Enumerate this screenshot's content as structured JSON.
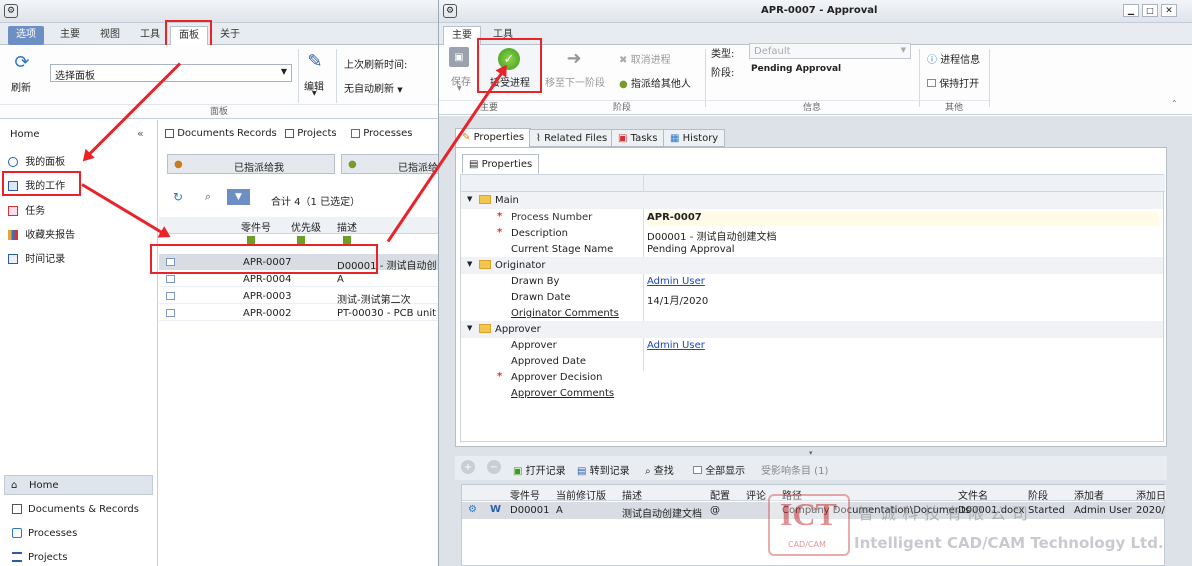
{
  "left": {
    "tabs": [
      "选项",
      "主要",
      "视图",
      "工具",
      "面板",
      "关于"
    ],
    "ribbon": {
      "refresh": "刷新",
      "panel_select": "选择面板",
      "edit": "编辑",
      "last_refresh_label": "上次刷新时间:",
      "auto_refresh": "无自动刷新",
      "group_label": "面板"
    },
    "nav": {
      "home": "Home",
      "items": [
        "我的面板",
        "我的工作",
        "任务",
        "收藏夹报告",
        "时间记录"
      ],
      "bottom": [
        "Home",
        "Documents & Records",
        "Processes",
        "Projects"
      ]
    },
    "content": {
      "tabs": [
        "Documents",
        "Records",
        "Projects",
        "Processes"
      ],
      "assigned_me": "已指派给我",
      "assigned_other": "已指派给",
      "summary": "合计 4（1 已选定）",
      "columns": [
        "零件号",
        "优先级",
        "描述"
      ],
      "rows": [
        {
          "id": "APR-0007",
          "desc": "D00001  -  测试自动创"
        },
        {
          "id": "APR-0004",
          "desc": "A"
        },
        {
          "id": "APR-0003",
          "desc": "测试-测试第二次"
        },
        {
          "id": "APR-0002",
          "desc": "PT-00030  -  PCB unit"
        }
      ]
    }
  },
  "right": {
    "title": "APR-0007 - Approval",
    "tabs": [
      "主要",
      "工具"
    ],
    "ribbon": {
      "save": "保存",
      "accept": "接受进程",
      "move_next": "移至下一阶段",
      "cancel": "取消进程",
      "assign_other": "指派给其他人",
      "type_label": "类型:",
      "type_value": "Default",
      "stage_label": "阶段:",
      "stage_value": "Pending Approval",
      "process_info": "进程信息",
      "keep_open": "保持打开",
      "groups": [
        "主要",
        "阶段",
        "信息",
        "其他"
      ]
    },
    "detail_tabs": [
      "Properties",
      "Related Files",
      "Tasks",
      "History"
    ],
    "sub_tab": "Properties",
    "props": {
      "main": "Main",
      "process_number_label": "Process Number",
      "process_number": "APR-0007",
      "description_label": "Description",
      "description": "D00001  -  测试自动创建文档",
      "stage_name_label": "Current Stage Name",
      "stage_name": "Pending Approval",
      "originator": "Originator",
      "drawn_by_label": "Drawn By",
      "drawn_by": "Admin User",
      "drawn_date_label": "Drawn Date",
      "drawn_date": "14/1月/2020",
      "orig_comments_label": "Originator Comments",
      "approver_group": "Approver",
      "approver_label": "Approver",
      "approver": "Admin User",
      "approved_date_label": "Approved Date",
      "decision_label": "Approver Decision",
      "approver_comments_label": "Approver Comments"
    },
    "files_toolbar": {
      "open_record": "打开记录",
      "goto_record": "转到记录",
      "find": "查找",
      "show_all": "全部显示",
      "affected": "受影响条目 (1)"
    },
    "files_columns": [
      "零件号",
      "当前修订版",
      "描述",
      "配置",
      "评论",
      "路径",
      "文件名",
      "阶段",
      "添加者",
      "添加日"
    ],
    "files_row": [
      "D00001",
      "A",
      "测试自动创建文档",
      "@",
      "",
      "Company Documentation\\Documents",
      "D00001.docx",
      "Started",
      "Admin User",
      "2020/"
    ]
  },
  "watermark": {
    "logo": "ICT",
    "sub": "CAD/CAM",
    "cn": "智诚科技有限公司",
    "en": "Intelligent CAD/CAM Technology Ltd."
  }
}
